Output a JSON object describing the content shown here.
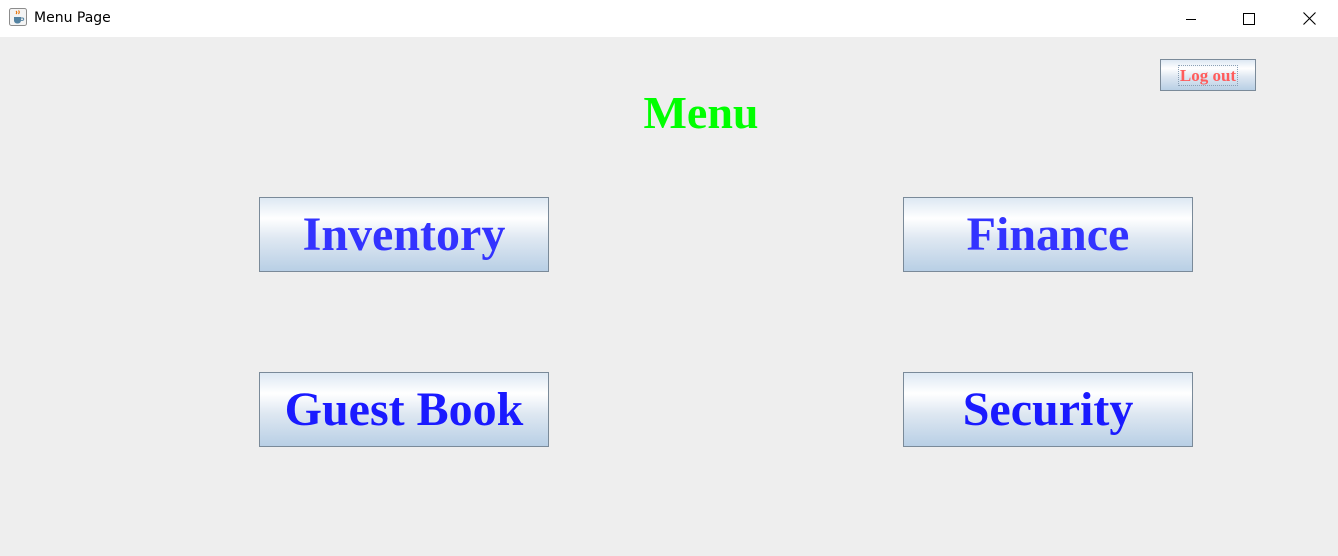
{
  "window": {
    "title": "Menu Page",
    "icon": "java-cup-icon",
    "controls": [
      "minimize-icon",
      "maximize-icon",
      "close-icon"
    ]
  },
  "header": {
    "title": "Menu",
    "title_color": "#00ff00"
  },
  "logout": {
    "label": "Log out",
    "color": "#ff5c5c"
  },
  "menu_buttons": [
    {
      "label": "Inventory",
      "color": "#3333ff"
    },
    {
      "label": "Finance",
      "color": "#3333ff"
    },
    {
      "label": "Guest Book",
      "color": "#1a1aff"
    },
    {
      "label": "Security",
      "color": "#1a1aff"
    }
  ]
}
